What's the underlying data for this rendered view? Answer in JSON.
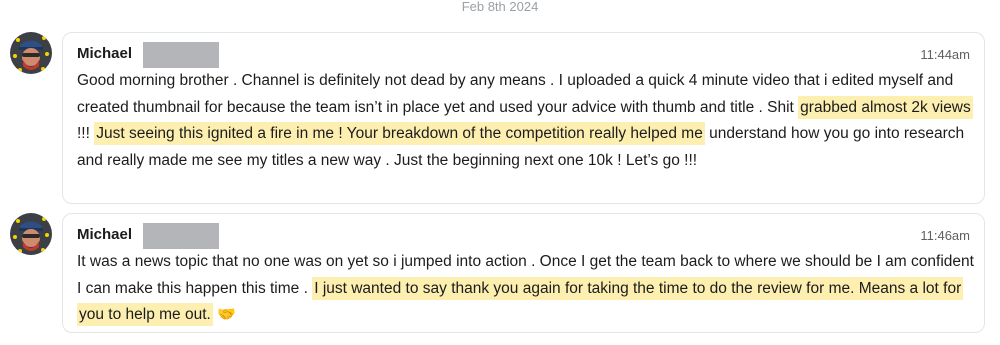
{
  "date_separator": "Feb 8th 2024",
  "messages": [
    {
      "sender": "Michael",
      "time": "11:44am",
      "p1": "Good morning brother . Channel is definitely not dead by any means . I uploaded a quick 4 minute video that i edited myself and created thumbnail for because the team isn’t in place yet and used your advice with thumb and title . Shit ",
      "hl1": "grabbed almost 2k views",
      "p2": " !!! ",
      "hl2": "Just seeing this ignited a fire in me ! Your breakdown of the competition really helped me",
      "p3": " understand how you go into research and really made me see my titles a new way . Just the beginning next one 10k ! Let’s go !!!"
    },
    {
      "sender": "Michael",
      "time": "11:46am",
      "p1": "It was a news topic that no one was on yet so i jumped into action . Once I get the team back to where we should be I am confident I can make this happen this time . ",
      "hl1": "I just wanted to say thank you again for taking the time to do the review for me. Means a lot for you to help me out.",
      "emoji": "🤝"
    }
  ],
  "colors": {
    "highlight": "#fcefb0",
    "bubble_border": "#e3e5e8",
    "redaction": "#b3b5b8"
  }
}
